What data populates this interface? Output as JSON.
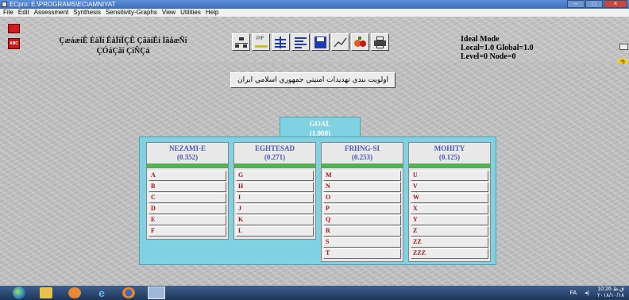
{
  "window": {
    "title": "ECpro: E:\\PROGRAMS\\EC\\AMNIYAT",
    "buttons": {
      "minimize": "–",
      "maximize": "□",
      "close": "×"
    }
  },
  "menu": [
    "File",
    "Edit",
    "Assessment",
    "Synthesis",
    "Sensitivity-Graphs",
    "View",
    "Utilities",
    "Help"
  ],
  "goal_description": {
    "line1": "ÇæáæíÊ ÈäÏí ÊåÏíÏÇÊ ÇãäíÊí ÌãåæÑí",
    "line2": "ÇÓáÇãí ÇíÑÇä"
  },
  "toolbar": {
    "icons": [
      "hierarchy-icon",
      "pairwise-icon",
      "tree-icon",
      "list-icon",
      "save-icon",
      "graph-icon",
      "fruits-icon",
      "print-icon"
    ],
    "pf_label": "P/F"
  },
  "status": {
    "mode": "Ideal Mode",
    "priorities": "Local=1.0 Global=1.0",
    "position": "Level=0  Node=0"
  },
  "help_label": "?",
  "persian_title": "اولويت بندي تهديدات امنيتي جمهوري اسلامي ايران",
  "goal": {
    "name": "GOAL",
    "value": "(1.000)"
  },
  "criteria": [
    {
      "name": "NEZAMI-E",
      "value": "(0.352)",
      "alternatives": [
        "A",
        "B",
        "C",
        "D",
        "E",
        "F"
      ]
    },
    {
      "name": "EGHTESAD",
      "value": "(0.271)",
      "alternatives": [
        "G",
        "H",
        "I",
        "J",
        "K",
        "L"
      ]
    },
    {
      "name": "FRHNG-SI",
      "value": "(0.253)",
      "alternatives": [
        "M",
        "N",
        "O",
        "P",
        "Q",
        "R",
        "S",
        "T"
      ]
    },
    {
      "name": "MOHITY",
      "value": "(0.125)",
      "alternatives": [
        "U",
        "V",
        "W",
        "X",
        "Y",
        "Z",
        "ZZ",
        "ZZZ"
      ]
    }
  ],
  "taskbar": {
    "tray": {
      "lang": "FA",
      "time": "10:26 ق.ظ",
      "date": "۲۰۱۸/۱۰/۱۸"
    }
  }
}
